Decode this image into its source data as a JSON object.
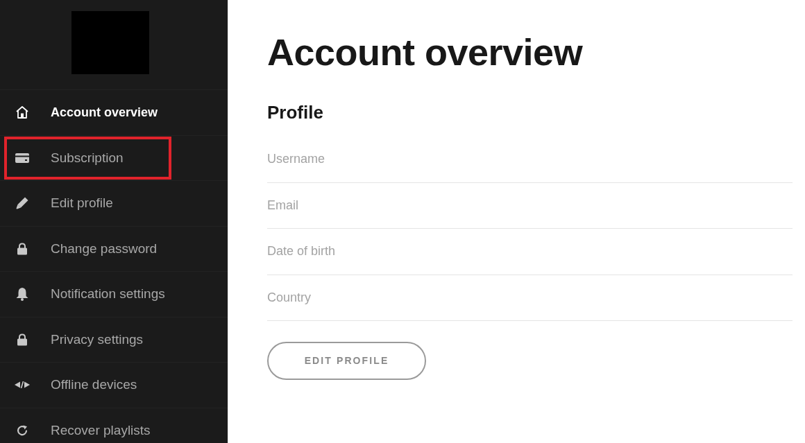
{
  "sidebar": {
    "items": [
      {
        "label": "Account overview",
        "selected": true,
        "highlighted": false
      },
      {
        "label": "Subscription",
        "selected": false,
        "highlighted": true
      },
      {
        "label": "Edit profile",
        "selected": false,
        "highlighted": false
      },
      {
        "label": "Change password",
        "selected": false,
        "highlighted": false
      },
      {
        "label": "Notification settings",
        "selected": false,
        "highlighted": false
      },
      {
        "label": "Privacy settings",
        "selected": false,
        "highlighted": false
      },
      {
        "label": "Offline devices",
        "selected": false,
        "highlighted": false
      },
      {
        "label": "Recover playlists",
        "selected": false,
        "highlighted": false
      }
    ]
  },
  "main": {
    "title": "Account overview",
    "profile": {
      "heading": "Profile",
      "fields": [
        {
          "label": "Username"
        },
        {
          "label": "Email"
        },
        {
          "label": "Date of birth"
        },
        {
          "label": "Country"
        }
      ]
    },
    "edit_button": "EDIT PROFILE"
  }
}
